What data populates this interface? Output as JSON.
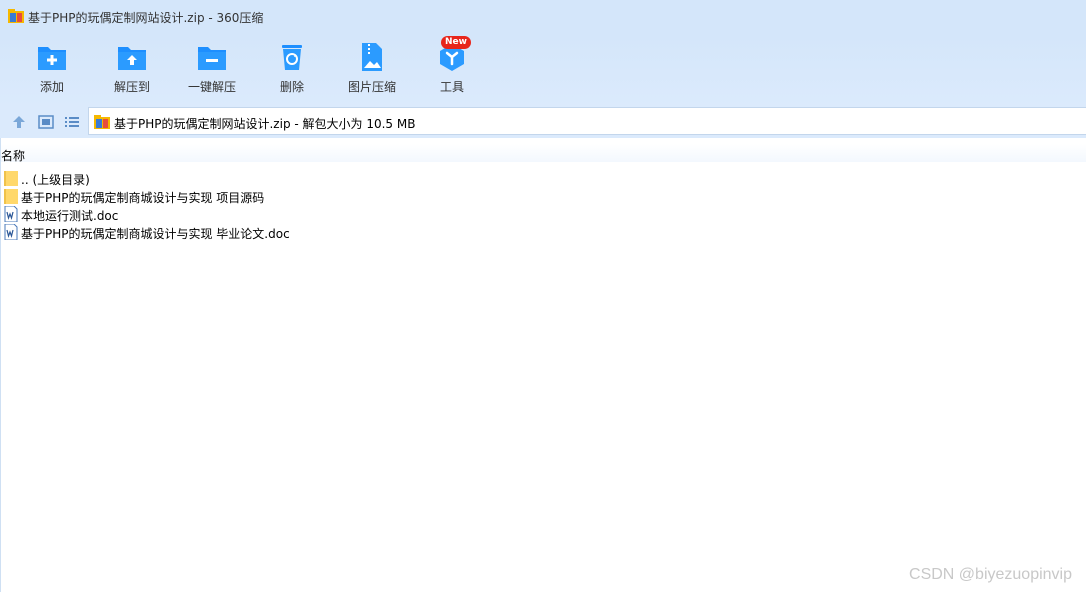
{
  "window": {
    "title": "基于PHP的玩偶定制网站设计.zip - 360压缩"
  },
  "toolbar": {
    "items": [
      {
        "label": "添加",
        "icon": "folder-add-icon"
      },
      {
        "label": "解压到",
        "icon": "folder-extract-icon"
      },
      {
        "label": "一键解压",
        "icon": "folder-oneclick-extract-icon"
      },
      {
        "label": "删除",
        "icon": "recycle-bin-icon"
      },
      {
        "label": "图片压缩",
        "icon": "image-compress-icon"
      },
      {
        "label": "工具",
        "icon": "tools-cube-icon",
        "badge": "New"
      }
    ]
  },
  "navbar": {
    "address": "基于PHP的玩偶定制网站设计.zip - 解包大小为 10.5 MB"
  },
  "list": {
    "column_name": "名称",
    "items": [
      {
        "name": ".. (上级目录)",
        "type": "folder"
      },
      {
        "name": "基于PHP的玩偶定制商城设计与实现 项目源码",
        "type": "folder"
      },
      {
        "name": "本地运行测试.doc",
        "type": "doc"
      },
      {
        "name": "基于PHP的玩偶定制商城设计与实现 毕业论文.doc",
        "type": "doc"
      }
    ]
  },
  "watermark": "CSDN @biyezuopinvip",
  "colors": {
    "accent": "#1e90ff",
    "folder": "#ffd86b",
    "badge": "#e8261b"
  }
}
